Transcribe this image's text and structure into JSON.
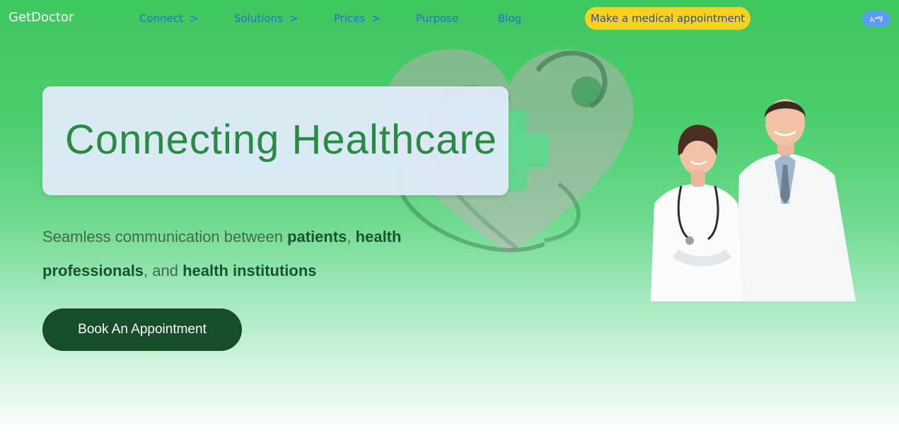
{
  "nav": {
    "brand": "GetDoctor",
    "links": [
      {
        "label": "Connect",
        "chevron": ">"
      },
      {
        "label": "Solutions",
        "chevron": ">"
      },
      {
        "label": "Prices",
        "chevron": ">"
      },
      {
        "label": "Purpose"
      },
      {
        "label": "Blog"
      }
    ],
    "appointment_button": "Make a medical appointment",
    "language_button": "አማ"
  },
  "hero": {
    "title": "Connecting Healthcare",
    "subtitle": {
      "intro": "Seamless communication between ",
      "patients": "patients",
      "sep1": ", ",
      "health_professionals": "health professionals",
      "sep2": ", and ",
      "health_institutions": "health institutions"
    },
    "cta": "Book An Appointment"
  },
  "colors": {
    "brand_green": "#3fc75f",
    "cta_dark_green": "#174d2a",
    "title_green": "#2a8a45",
    "accent_yellow": "#f9d21b",
    "link_blue": "#2a6bd6",
    "lang_blue": "#5b9cf5"
  },
  "icons": [
    "heart-stethoscope-illustration",
    "doctors-photo"
  ]
}
